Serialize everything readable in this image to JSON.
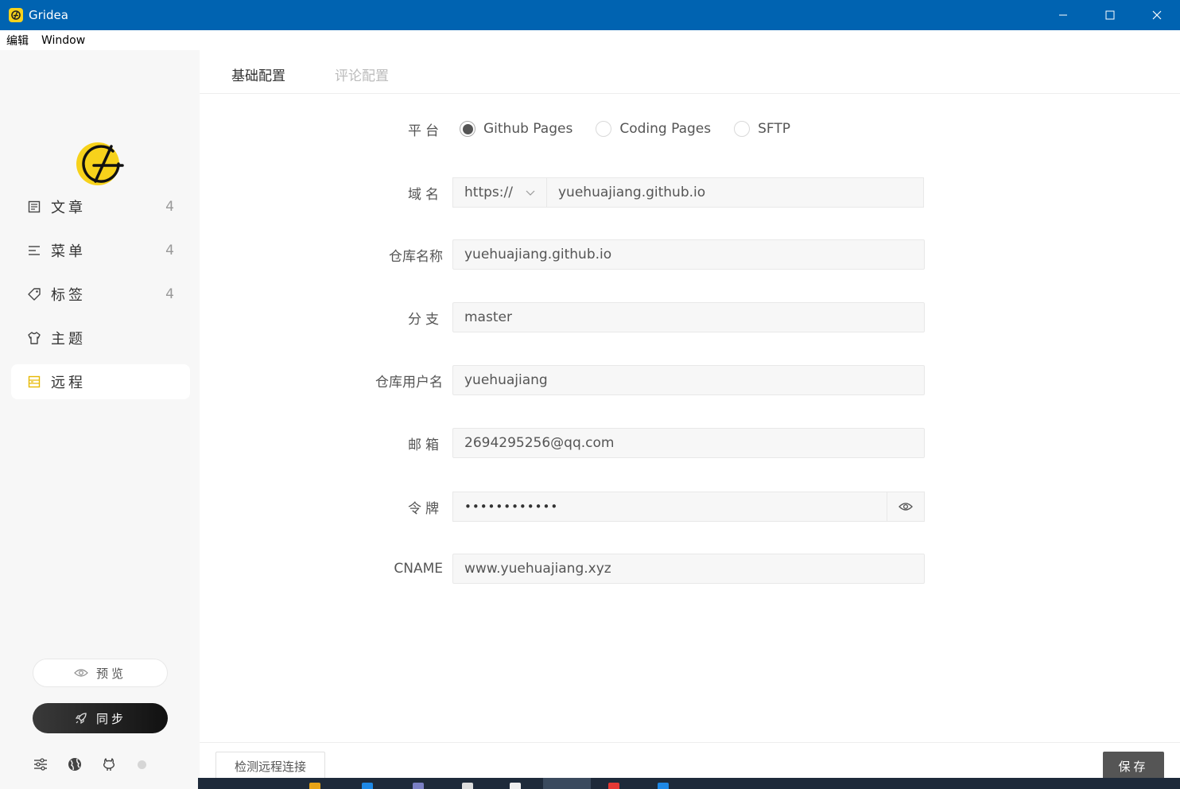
{
  "window": {
    "title": "Gridea",
    "minimize_icon": "minimize-icon",
    "maximize_icon": "maximize-icon",
    "close_icon": "close-icon"
  },
  "menubar": {
    "items": [
      "编辑",
      "Window"
    ]
  },
  "sidebar": {
    "logo_icon": "gridea-logo",
    "items": [
      {
        "label": "文章",
        "count": "4",
        "icon": "article-icon"
      },
      {
        "label": "菜单",
        "count": "4",
        "icon": "menu-icon"
      },
      {
        "label": "标签",
        "count": "4",
        "icon": "tag-icon"
      },
      {
        "label": "主题",
        "count": "",
        "icon": "shirt-icon"
      },
      {
        "label": "远程",
        "count": "",
        "icon": "server-icon",
        "active": true
      }
    ],
    "preview_label": "预览",
    "sync_label": "同步",
    "tools": [
      "settings-sliders-icon",
      "globe-icon",
      "github-icon",
      "status-dot"
    ]
  },
  "tabs": {
    "basic": "基础配置",
    "comment": "评论配置",
    "active": "basic"
  },
  "form": {
    "platform": {
      "label": "平台",
      "options": [
        "Github Pages",
        "Coding Pages",
        "SFTP"
      ],
      "selected": "Github Pages"
    },
    "domain": {
      "label": "域名",
      "protocol": "https://",
      "value": "yuehuajiang.github.io"
    },
    "repo": {
      "label": "仓库名称",
      "value": "yuehuajiang.github.io"
    },
    "branch": {
      "label": "分支",
      "value": "master"
    },
    "username": {
      "label": "仓库用户名",
      "value": "yuehuajiang"
    },
    "email": {
      "label": "邮箱",
      "value": "2694295256@qq.com"
    },
    "token": {
      "label": "令牌",
      "value": "••••••••••••"
    },
    "cname": {
      "label": "CNAME",
      "value": "www.yuehuajiang.xyz"
    }
  },
  "footer": {
    "check_label": "检测远程连接",
    "save_label": "保存"
  },
  "colors": {
    "titlebar": "#0063b1",
    "accent": "#f7d21b",
    "save": "#555555"
  }
}
